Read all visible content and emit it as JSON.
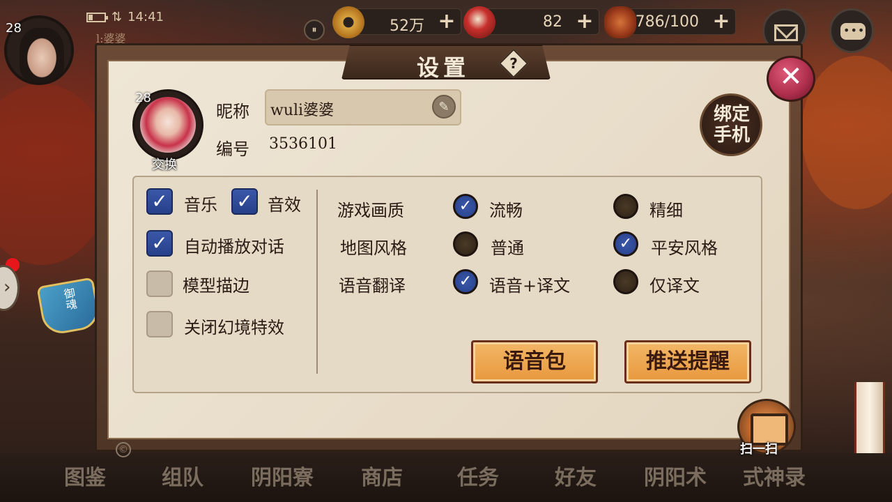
{
  "status": {
    "time": "14:41",
    "player_level": "28",
    "sub_name": "l:婆婆"
  },
  "resources": [
    {
      "name": "coin",
      "value": "52万"
    },
    {
      "name": "magatama",
      "value": "82"
    },
    {
      "name": "stamina",
      "value": "786/100"
    }
  ],
  "settings": {
    "title": "设置",
    "help_icon": "?",
    "close_icon": "✕",
    "profile": {
      "level": "28",
      "swap_label": "交换",
      "nickname_label": "昵称",
      "nickname_value": "wuli婆婆",
      "id_label": "编号",
      "id_value": "3536101"
    },
    "bind_phone_label": "绑定手机",
    "left_options": {
      "music": {
        "label": "音乐",
        "checked": true
      },
      "sfx": {
        "label": "音效",
        "checked": true
      },
      "auto_dialog": {
        "label": "自动播放对话",
        "checked": true
      },
      "model_outline": {
        "label": "模型描边",
        "checked": false
      },
      "disable_illusion": {
        "label": "关闭幻境特效",
        "checked": false
      }
    },
    "right_options": {
      "quality": {
        "label": "游戏画质",
        "opt1": "流畅",
        "opt2": "精细",
        "selected": "流畅"
      },
      "map_style": {
        "label": "地图风格",
        "opt1": "普通",
        "opt2": "平安风格",
        "selected": "平安风格"
      },
      "voice_translation": {
        "label": "语音翻译",
        "opt1": "语音+译文",
        "opt2": "仅译文",
        "selected": "语音+译文"
      }
    },
    "voice_pack_label": "语音包",
    "push_reminder_label": "推送提醒"
  },
  "side": {
    "charm_text": "御魂",
    "scan_label": "扫一扫",
    "copyright_icon": "©",
    "arrow_icon": "›"
  },
  "bottom_nav": [
    "图鉴",
    "组队",
    "阴阳寮",
    "商店",
    "任务",
    "好友",
    "阴阳术",
    "式神录"
  ],
  "icons": {
    "checkmark": "✓",
    "plus": "+",
    "pause": "⏸",
    "edit": "✎"
  }
}
